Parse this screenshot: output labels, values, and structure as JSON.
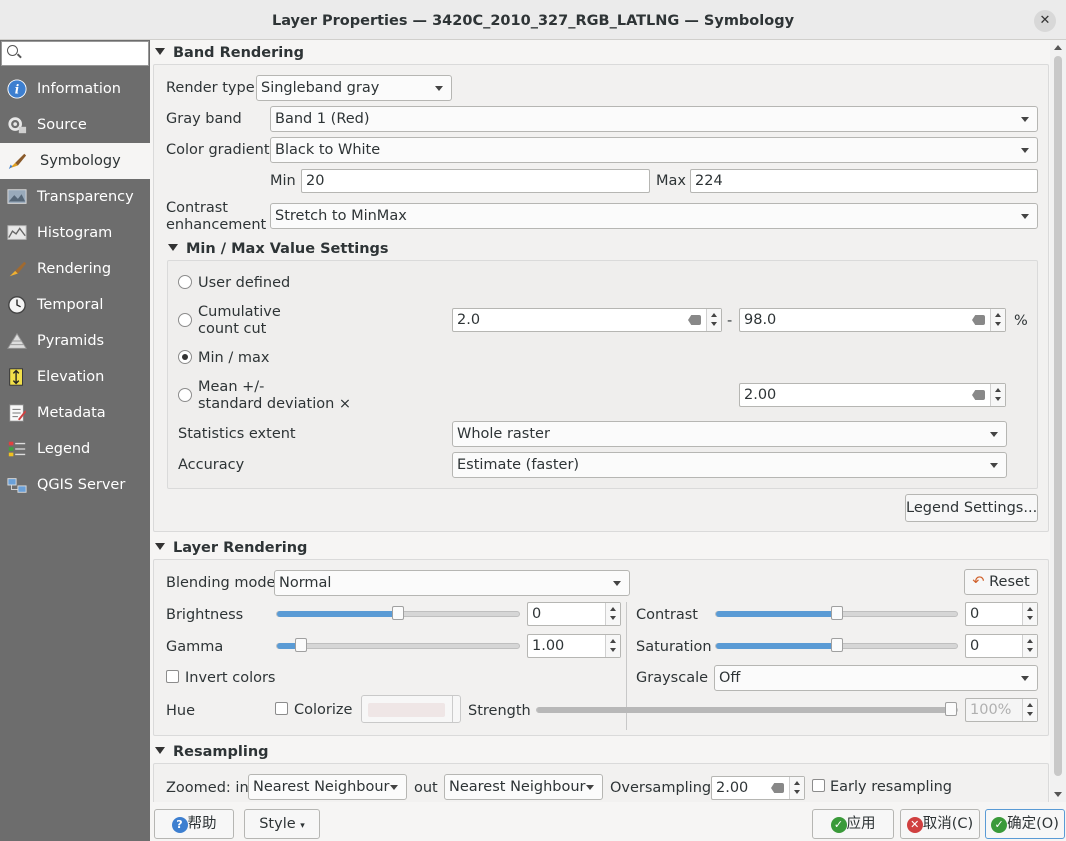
{
  "window": {
    "title": "Layer Properties — 3420C_2010_327_RGB_LATLNG — Symbology"
  },
  "sidebar": {
    "search_placeholder": "",
    "items": [
      {
        "label": "Information",
        "icon": "info-icon"
      },
      {
        "label": "Source",
        "icon": "source-icon"
      },
      {
        "label": "Symbology",
        "icon": "symbology-brush-icon",
        "active": true
      },
      {
        "label": "Transparency",
        "icon": "transparency-icon"
      },
      {
        "label": "Histogram",
        "icon": "histogram-icon"
      },
      {
        "label": "Rendering",
        "icon": "rendering-brush-icon"
      },
      {
        "label": "Temporal",
        "icon": "clock-icon"
      },
      {
        "label": "Pyramids",
        "icon": "pyramids-icon"
      },
      {
        "label": "Elevation",
        "icon": "elevation-icon"
      },
      {
        "label": "Metadata",
        "icon": "metadata-icon"
      },
      {
        "label": "Legend",
        "icon": "legend-icon"
      },
      {
        "label": "QGIS Server",
        "icon": "server-icon"
      }
    ]
  },
  "band_rendering": {
    "header": "Band Rendering",
    "render_type_label": "Render type",
    "render_type": "Singleband gray",
    "gray_band_label": "Gray band",
    "gray_band": "Band 1 (Red)",
    "color_gradient_label": "Color gradient",
    "color_gradient": "Black to White",
    "min_label": "Min",
    "min_value": "20",
    "max_label": "Max",
    "max_value": "224",
    "contrast_label_1": "Contrast",
    "contrast_label_2": "enhancement",
    "contrast": "Stretch to MinMax"
  },
  "minmax": {
    "header": "Min / Max Value Settings",
    "user_defined": "User defined",
    "cumulative_1": "Cumulative",
    "cumulative_2": "count cut",
    "cum_low": "2.0",
    "dash": "-",
    "cum_high": "98.0",
    "percent": "%",
    "minmax": "Min / max",
    "mean_1": "Mean +/-",
    "mean_2": "standard deviation ×",
    "stddev": "2.00",
    "stats_extent_label": "Statistics extent",
    "stats_extent": "Whole raster",
    "accuracy_label": "Accuracy",
    "accuracy": "Estimate (faster)",
    "selected": "minmax"
  },
  "legend_settings_button": "Legend Settings...",
  "layer_rendering": {
    "header": "Layer Rendering",
    "blending_label": "Blending mode",
    "blending": "Normal",
    "reset": "Reset",
    "brightness_label": "Brightness",
    "brightness": "0",
    "brightness_level": 0.5,
    "contrast_label": "Contrast",
    "contrast": "0",
    "contrast_level": 0.5,
    "gamma_label": "Gamma",
    "gamma": "1.00",
    "gamma_level": 0.1,
    "saturation_label": "Saturation",
    "saturation": "0",
    "saturation_level": 0.5,
    "invert_label": "Invert colors",
    "grayscale_label": "Grayscale",
    "grayscale": "Off",
    "hue_label": "Hue",
    "colorize_label": "Colorize",
    "strength_label": "Strength",
    "strength": "100%",
    "strength_level": 1.0
  },
  "resampling": {
    "header": "Resampling",
    "zoomed_in_label": "Zoomed: in",
    "zoomed_in": "Nearest Neighbour",
    "out_label": "out",
    "zoomed_out": "Nearest Neighbour",
    "oversampling_label": "Oversampling",
    "oversampling": "2.00",
    "early_label": "Early resampling"
  },
  "footer": {
    "help": "帮助",
    "style": "Style",
    "apply": "应用",
    "cancel": "取消(C)",
    "ok": "确定(O)"
  },
  "colors": {
    "accent": "#5a9bd5",
    "sidebar_bg": "#6d6d6d"
  }
}
